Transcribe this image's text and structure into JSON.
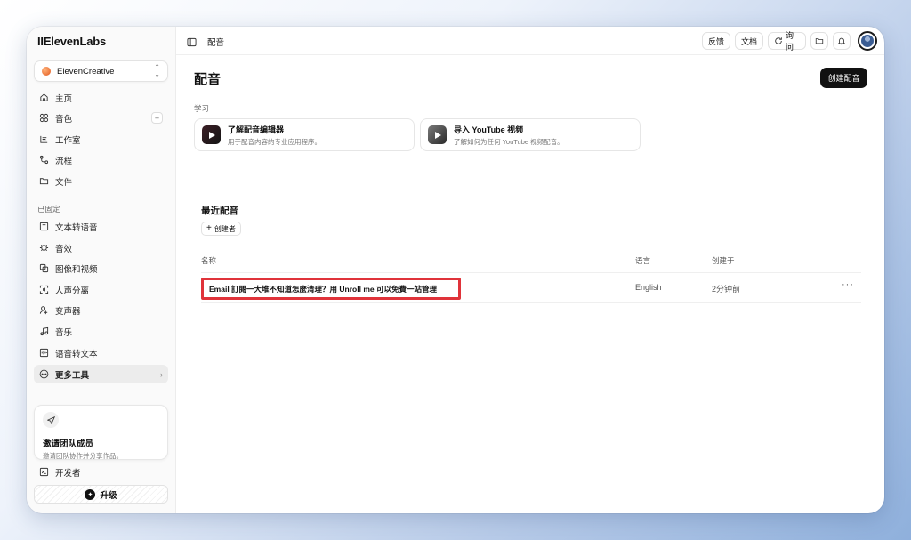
{
  "app": {
    "logo": "IIElevenLabs"
  },
  "workspace": {
    "name": "ElevenCreative"
  },
  "sidebar": {
    "nav": [
      {
        "label": "主页",
        "icon": "home-icon"
      },
      {
        "label": "音色",
        "icon": "voices-grid-icon",
        "plus": "+"
      },
      {
        "label": "工作室",
        "icon": "studio-icon"
      },
      {
        "label": "流程",
        "icon": "flows-icon"
      },
      {
        "label": "文件",
        "icon": "folder-icon"
      }
    ],
    "pinned_label": "已固定",
    "pinned": [
      {
        "label": "文本转语音",
        "icon": "tts-icon"
      },
      {
        "label": "音效",
        "icon": "sound-effects-icon"
      },
      {
        "label": "图像和视频",
        "icon": "image-video-icon"
      },
      {
        "label": "人声分离",
        "icon": "voice-isolator-icon"
      },
      {
        "label": "变声器",
        "icon": "voice-changer-icon"
      },
      {
        "label": "音乐",
        "icon": "music-icon"
      },
      {
        "label": "语音转文本",
        "icon": "stt-icon"
      },
      {
        "label": "更多工具",
        "icon": "more-tools-icon",
        "chevron": "›"
      }
    ],
    "invite": {
      "title": "邀请团队成员",
      "subtitle": "邀请团队协作并分享作品。"
    },
    "developer": "开发者",
    "upgrade": "升级"
  },
  "topbar": {
    "breadcrumb": "配音",
    "feedback": "反馈",
    "docs": "文档",
    "ask": "询问"
  },
  "main": {
    "title": "配音",
    "create_button": "创建配音",
    "learn_label": "学习",
    "learn_cards": [
      {
        "title": "了解配音编辑器",
        "subtitle": "用于配音内容的专业应用程序。"
      },
      {
        "title": "导入 YouTube 视频",
        "subtitle": "了解如何为任何 YouTube 视频配音。"
      }
    ],
    "recent_title": "最近配音",
    "filter_chip": "创建者",
    "table": {
      "headers": {
        "name": "名称",
        "language": "语言",
        "created": "创建于"
      },
      "rows": [
        {
          "name": "Email 訂閱一大堆不知道怎麼清理？用 Unroll me 可以免費一站管理",
          "language": "English",
          "created": "2分钟前",
          "more": "···"
        }
      ]
    }
  },
  "colors": {
    "highlight": "#e0333a",
    "primary_button": "#111111"
  }
}
